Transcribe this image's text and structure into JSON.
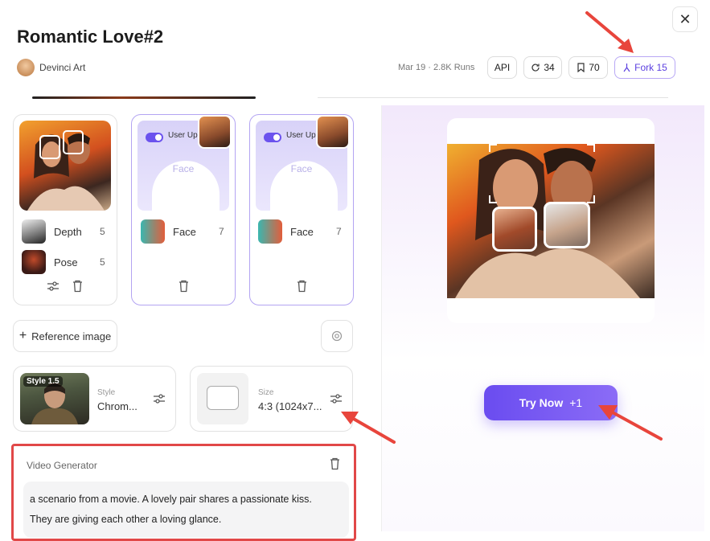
{
  "title": "Romantic Love#2",
  "author": {
    "name": "Devinci Art"
  },
  "meta": "Mar 19 · 2.8K Runs",
  "chips": {
    "api": "API",
    "remix": "34",
    "save": "70",
    "fork": "Fork 15"
  },
  "cards": [
    {
      "controls": [
        {
          "label": "Depth",
          "value": "5"
        },
        {
          "label": "Pose",
          "value": "5"
        }
      ]
    },
    {
      "toggle_label": "User Up",
      "area_label": "Face",
      "control": {
        "label": "Face",
        "value": "7"
      }
    },
    {
      "toggle_label": "User Up",
      "area_label": "Face",
      "control": {
        "label": "Face",
        "value": "7"
      }
    }
  ],
  "reference": {
    "label": "Reference image"
  },
  "style": {
    "badge": "Style 1.5",
    "label": "Style",
    "value": "Chrom..."
  },
  "size": {
    "label": "Size",
    "value": "4:3 (1024x7..."
  },
  "video": {
    "title": "Video Generator",
    "prompt_line1": "a scenario from a movie. A lovely pair shares a passionate kiss.",
    "prompt_line2": "They are giving each other a loving glance."
  },
  "try_button": {
    "label": "Try Now",
    "cost": "+1"
  },
  "colors": {
    "accent": "#6a4cf0",
    "highlight": "#e14848",
    "arrow": "#e8453c"
  }
}
